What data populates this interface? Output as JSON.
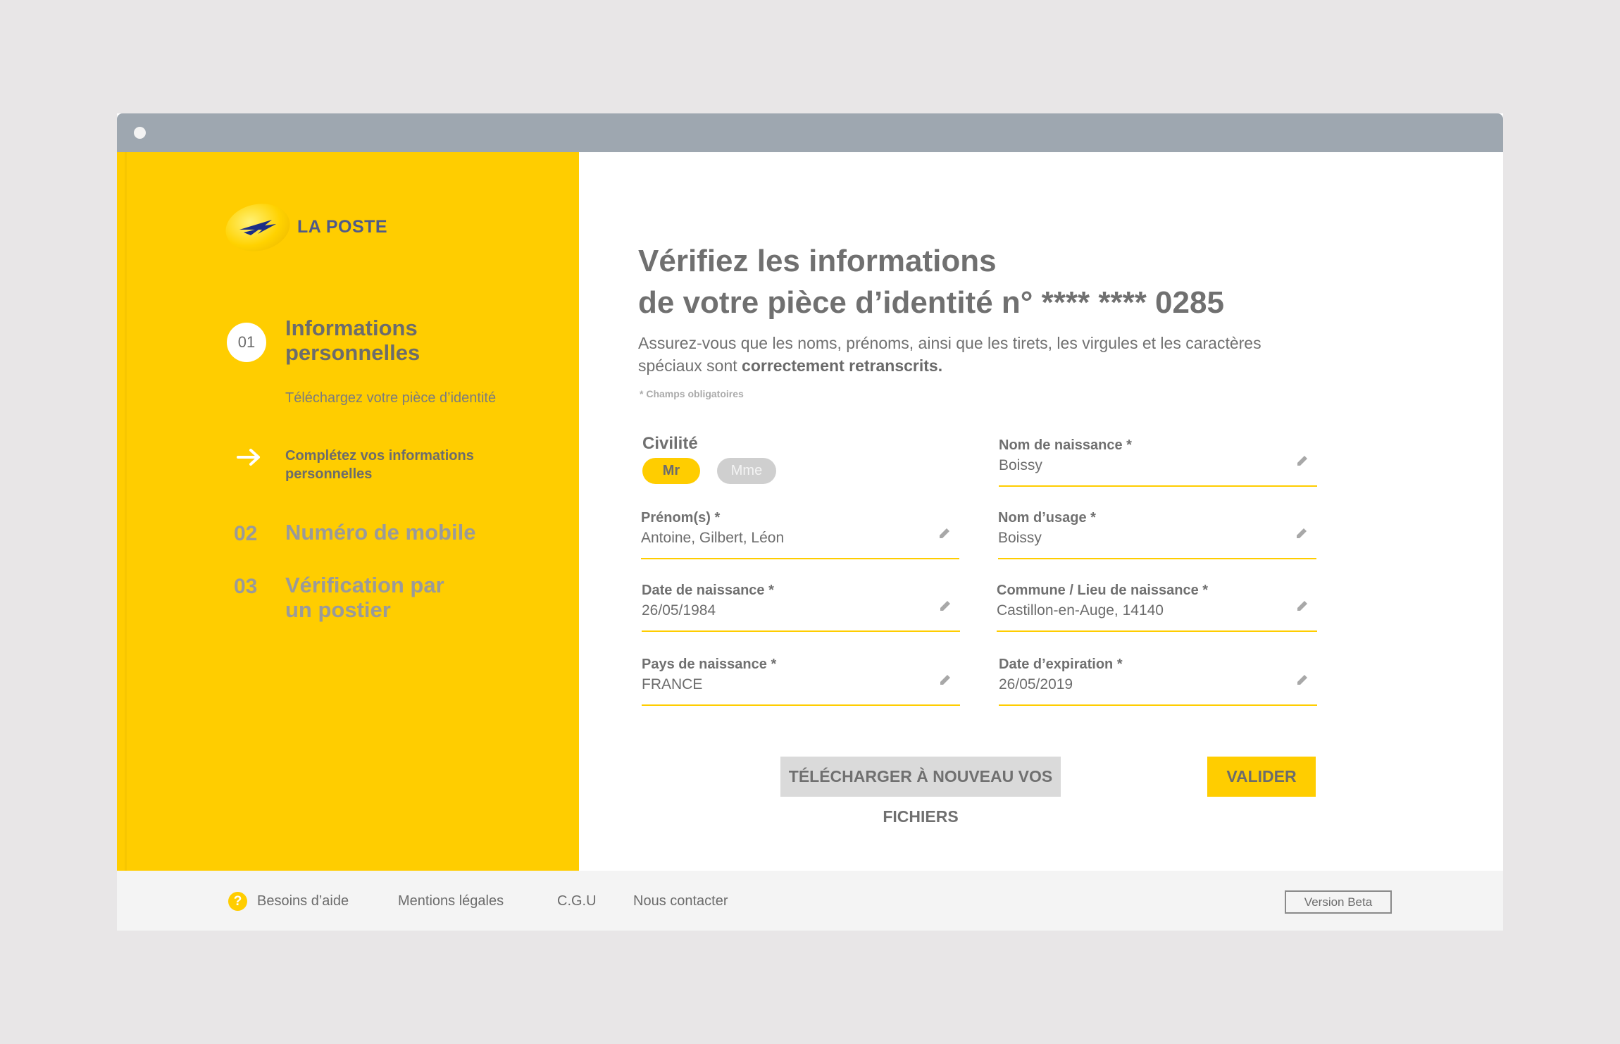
{
  "brand": {
    "name": "LA POSTE",
    "accent": "#ffcd00",
    "logo_blue": "#1b2e86"
  },
  "sidebar": {
    "step1": {
      "number": "01",
      "title": "Informations personnelles"
    },
    "sub_steps": [
      {
        "label": "Téléchargez votre pièce d’identité"
      },
      {
        "label": "Complétez vos informations personnelles",
        "icon": "arrow-right-icon"
      }
    ],
    "step2": {
      "number": "02",
      "title": "Numéro de mobile"
    },
    "step3": {
      "number": "03",
      "title": "Vérification par un postier"
    }
  },
  "main": {
    "title_line1": "Vérifiez les informations",
    "title_line2": "de votre pièce d’identité n° **** **** 0285",
    "intro_text": "Assurez-vous que les noms, prénoms, ainsi que les tirets, les virgules et les caractères spéciaux sont",
    "intro_bold": "correctement retranscrits.",
    "required_note": "* Champs obligatoires",
    "civilite": {
      "label": "Civilité",
      "options": [
        "Mr",
        "Mme"
      ],
      "selected": "Mr"
    },
    "fields": {
      "nom_naissance": {
        "label": "Nom de naissance *",
        "value": "Boissy"
      },
      "prenoms": {
        "label": "Prénom(s) *",
        "value": "Antoine, Gilbert, Léon"
      },
      "nom_usage": {
        "label": "Nom d’usage *",
        "value": "Boissy"
      },
      "date_naissance": {
        "label": "Date de naissance *",
        "value": "26/05/1984"
      },
      "commune": {
        "label": "Commune / Lieu de naissance *",
        "value": "Castillon-en-Auge, 14140"
      },
      "pays": {
        "label": "Pays de naissance *",
        "value": "FRANCE"
      },
      "date_expiration": {
        "label": "Date d’expiration *",
        "value": "26/05/2019"
      }
    },
    "buttons": {
      "reupload": "TÉLÉCHARGER À NOUVEAU VOS FICHIERS",
      "validate": "VALIDER"
    }
  },
  "footer": {
    "help_icon": "?",
    "links": [
      "Besoins d’aide",
      "Mentions légales",
      "C.G.U",
      "Nous contacter"
    ],
    "beta_label": "Version Beta"
  }
}
